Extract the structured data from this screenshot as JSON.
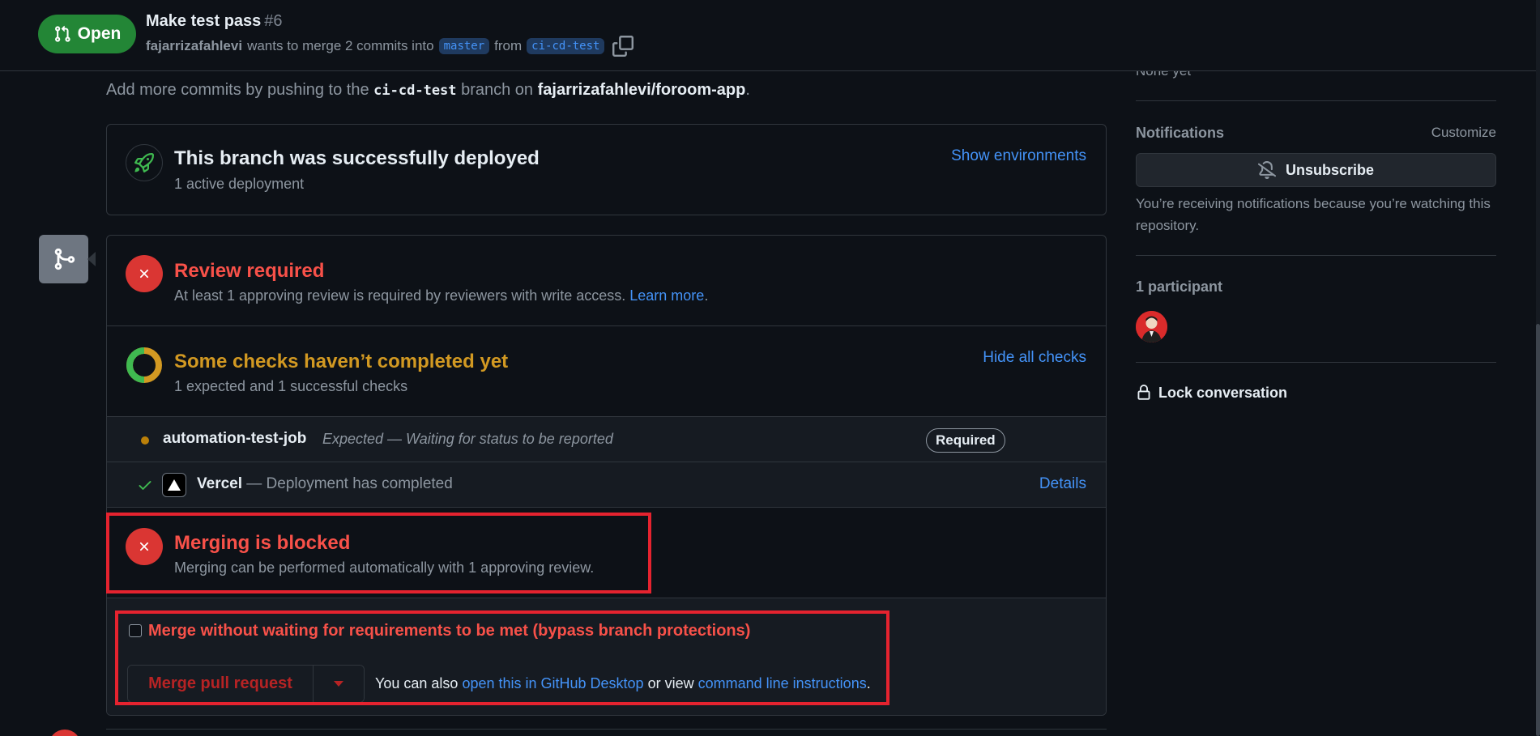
{
  "header": {
    "state": "Open",
    "title": "Make test pass",
    "number": "#6",
    "author": "fajarrizafahlevi",
    "merge_text": "wants to merge 2 commits into",
    "base_branch": "master",
    "from_text": "from",
    "head_branch": "ci-cd-test"
  },
  "hint": {
    "prefix": "Add more commits by pushing to the",
    "branch": "ci-cd-test",
    "middle": "branch on",
    "repo": "fajarrizafahlevi/foroom-app",
    "suffix": "."
  },
  "deployment": {
    "title": "This branch was successfully deployed",
    "subtitle": "1 active deployment",
    "link": "Show environments"
  },
  "review": {
    "title": "Review required",
    "text": "At least 1 approving review is required by reviewers with write access.",
    "link": "Learn more",
    "link_suffix": "."
  },
  "checks": {
    "title": "Some checks haven’t completed yet",
    "subtitle": "1 expected and 1 successful checks",
    "link": "Hide all checks",
    "items": [
      {
        "name": "automation-test-job",
        "description": "Expected — Waiting for status to be reported",
        "badge": "Required"
      },
      {
        "name": "Vercel",
        "description": "— Deployment has completed",
        "link": "Details"
      }
    ]
  },
  "blocked": {
    "title": "Merging is blocked",
    "subtitle": "Merging can be performed automatically with 1 approving review."
  },
  "merge": {
    "bypass_label": "Merge without waiting for requirements to be met (bypass branch protections)",
    "button": "Merge pull request",
    "also_prefix": "You can also",
    "desktop_link": "open this in GitHub Desktop",
    "or_view": "or view",
    "cli_link": "command line instructions",
    "suffix": "."
  },
  "sidebar": {
    "milestone_value": "None yet",
    "notifications_heading": "Notifications",
    "customize": "Customize",
    "unsubscribe": "Unsubscribe",
    "notification_note": "You’re receiving notifications because you’re watching this repository.",
    "participants_heading": "1 participant",
    "lock": "Lock conversation"
  },
  "colors": {
    "open_badge": "#238636",
    "danger": "#da3633",
    "danger_text": "#f85149",
    "pending": "#d29922",
    "success": "#3fb950",
    "link": "#4493f8",
    "annotation_box": "#e5232f"
  },
  "icons": [
    "git-pull-request-icon",
    "copy-icon",
    "rocket-icon",
    "git-merge-icon",
    "x-icon",
    "check-progress-ring-icon",
    "pending-dot-icon",
    "check-icon",
    "vercel-triangle-icon",
    "chevron-down-icon",
    "bell-slash-icon",
    "lock-icon"
  ]
}
